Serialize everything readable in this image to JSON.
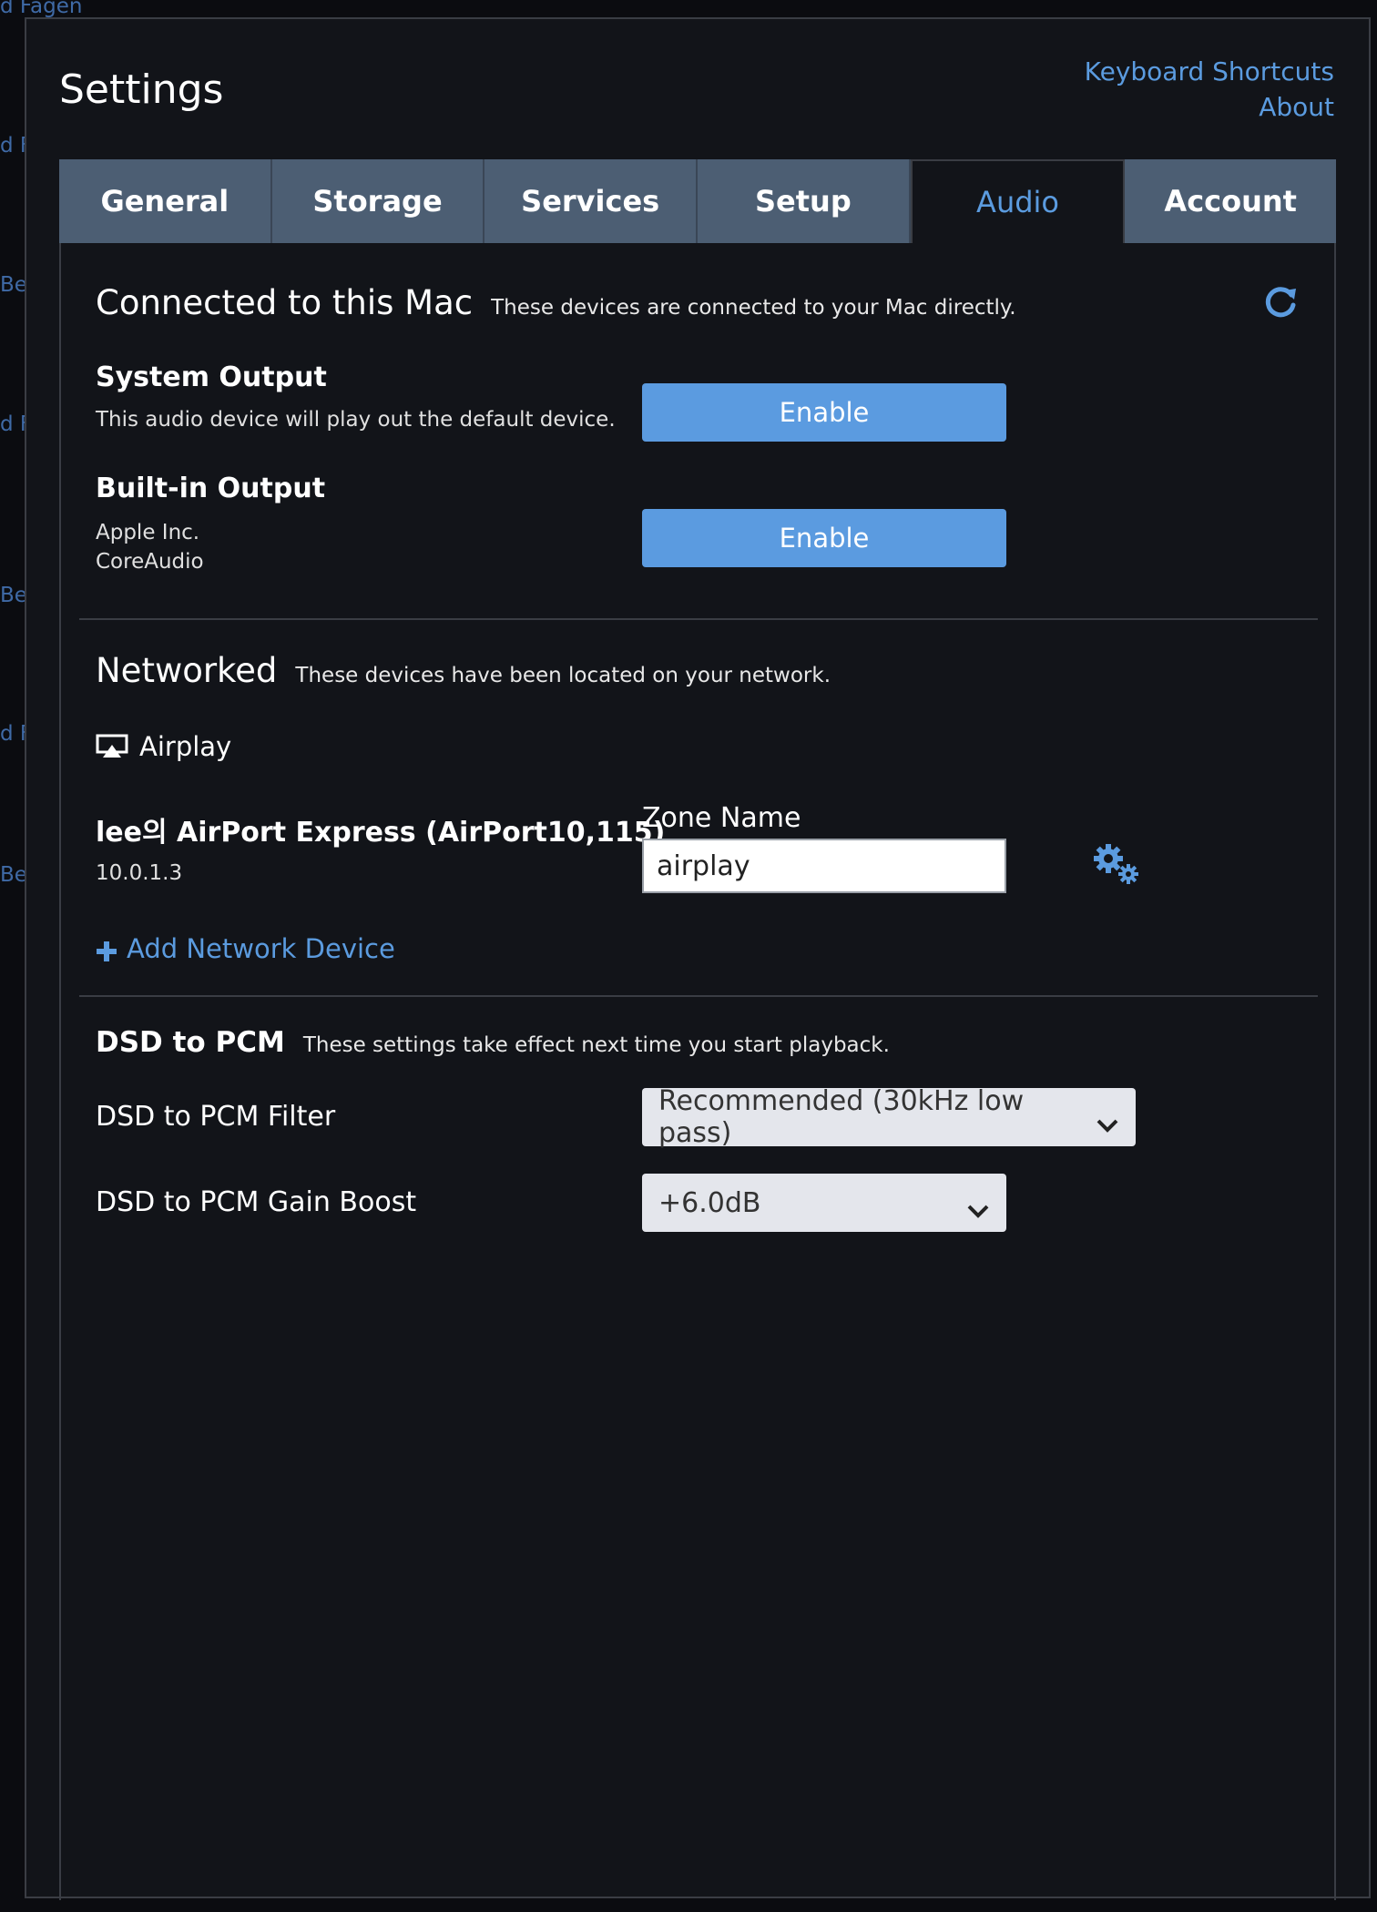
{
  "background": {
    "fragments": [
      "d Fagen",
      "d F",
      "Be",
      "d F",
      "Be",
      "d F",
      "Be"
    ]
  },
  "header": {
    "title": "Settings",
    "links": [
      "Keyboard Shortcuts",
      "About"
    ]
  },
  "tabs": [
    {
      "label": "General",
      "active": false
    },
    {
      "label": "Storage",
      "active": false
    },
    {
      "label": "Services",
      "active": false
    },
    {
      "label": "Setup",
      "active": false
    },
    {
      "label": "Audio",
      "active": true
    },
    {
      "label": "Account",
      "active": false
    }
  ],
  "connected": {
    "title": "Connected to this Mac",
    "description": "These devices are connected to your Mac directly.",
    "refresh_icon": "refresh-icon",
    "devices": [
      {
        "name": "System Output",
        "subtitle": "This audio device will play out the default device.",
        "button": "Enable"
      },
      {
        "name": "Built-in Output",
        "line1": "Apple Inc.",
        "line2": "CoreAudio",
        "button": "Enable"
      }
    ]
  },
  "networked": {
    "title": "Networked",
    "description": "These devices have been located on your network.",
    "group": {
      "icon": "airplay-icon",
      "label": "Airplay"
    },
    "device": {
      "name": "lee의 AirPort Express (AirPort10,115)",
      "ip": "10.0.1.3",
      "zone_label": "Zone Name",
      "zone_value": "airplay",
      "settings_icon": "gears-icon"
    },
    "add_label": "Add Network Device"
  },
  "dsd": {
    "title": "DSD to PCM",
    "description": "These settings take effect next time you start playback.",
    "filter_label": "DSD to PCM Filter",
    "filter_value": "Recommended (30kHz low pass)",
    "gain_label": "DSD to PCM Gain Boost",
    "gain_value": "+6.0dB"
  },
  "colors": {
    "accent": "#5b9bdf",
    "tab_bg": "#4c5e73",
    "panel_bg": "#121419"
  }
}
